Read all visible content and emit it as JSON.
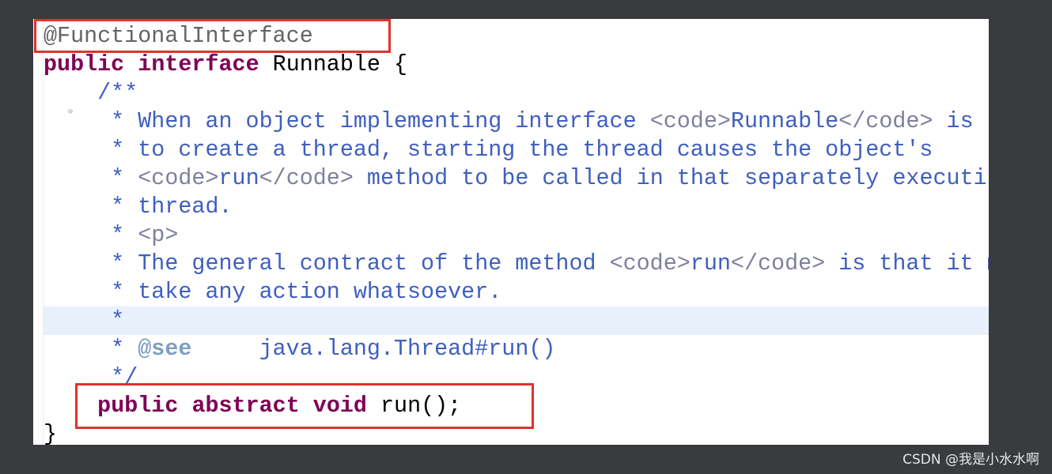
{
  "colors": {
    "keyword": "#7f0055",
    "comment": "#3f5fbf",
    "html_tag": "#7f7f9f",
    "annotation": "#646464",
    "highlight_box": "#e0332b",
    "current_line": "#e8f0fc"
  },
  "highlighted_line": 11,
  "lines": [
    [
      {
        "t": "@FunctionalInterface",
        "c": "ann"
      }
    ],
    [
      {
        "t": "public",
        "c": "kw"
      },
      {
        "t": " ",
        "c": "pl"
      },
      {
        "t": "interface",
        "c": "kw"
      },
      {
        "t": " Runnable {",
        "c": "pl"
      }
    ],
    [
      {
        "t": "    /**",
        "c": "cm"
      }
    ],
    [
      {
        "t": "     * When an object implementing interface ",
        "c": "cm"
      },
      {
        "t": "<code>",
        "c": "tag"
      },
      {
        "t": "Runnable",
        "c": "cm"
      },
      {
        "t": "</code>",
        "c": "tag"
      },
      {
        "t": " is used",
        "c": "cm"
      }
    ],
    [
      {
        "t": "     * to create a thread, starting the thread causes the object's",
        "c": "cm"
      }
    ],
    [
      {
        "t": "     * ",
        "c": "cm"
      },
      {
        "t": "<code>",
        "c": "tag"
      },
      {
        "t": "run",
        "c": "cm"
      },
      {
        "t": "</code>",
        "c": "tag"
      },
      {
        "t": " method to be called in that separately executing",
        "c": "cm"
      }
    ],
    [
      {
        "t": "     * thread.",
        "c": "cm"
      }
    ],
    [
      {
        "t": "     * ",
        "c": "cm"
      },
      {
        "t": "<p>",
        "c": "tag"
      }
    ],
    [
      {
        "t": "     * The general contract of the method ",
        "c": "cm"
      },
      {
        "t": "<code>",
        "c": "tag"
      },
      {
        "t": "run",
        "c": "cm"
      },
      {
        "t": "</code>",
        "c": "tag"
      },
      {
        "t": " is that it may",
        "c": "cm"
      }
    ],
    [
      {
        "t": "     * take any action whatsoever.",
        "c": "cm"
      }
    ],
    [
      {
        "t": "     *",
        "c": "cm"
      }
    ],
    [
      {
        "t": "     * ",
        "c": "cm"
      },
      {
        "t": "@see",
        "c": "see"
      },
      {
        "t": "     java.lang.Thread#run()",
        "c": "cm"
      }
    ],
    [
      {
        "t": "     */",
        "c": "cm"
      }
    ],
    [
      {
        "t": "    ",
        "c": "pl"
      },
      {
        "t": "public",
        "c": "kw"
      },
      {
        "t": " ",
        "c": "pl"
      },
      {
        "t": "abstract",
        "c": "kw"
      },
      {
        "t": " ",
        "c": "pl"
      },
      {
        "t": "void",
        "c": "kw"
      },
      {
        "t": " run();",
        "c": "pl"
      }
    ],
    [
      {
        "t": "}",
        "c": "pl"
      }
    ]
  ],
  "watermark": "CSDN @我是小水水啊"
}
